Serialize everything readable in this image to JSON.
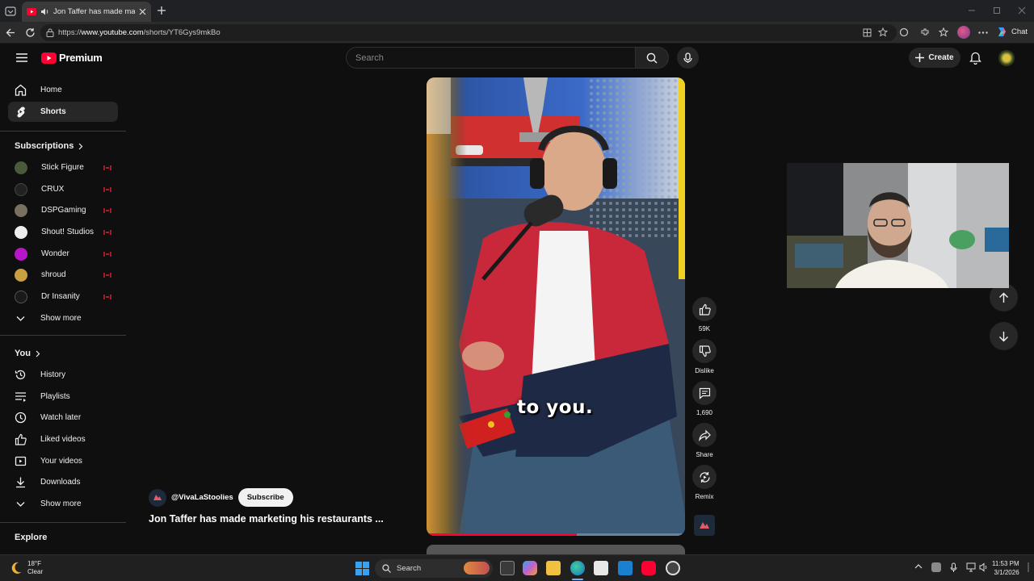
{
  "browser": {
    "tab_title": "Jon Taffer has made marketing his restaurants a",
    "url_prefix": "https://",
    "url_host": "www.youtube.com",
    "url_path": "/shorts/YT6Gys9mkBo",
    "chat_label": "Chat"
  },
  "header": {
    "logo_text": "Premium",
    "search_placeholder": "Search",
    "create_label": "Create"
  },
  "sidebar": {
    "main": [
      {
        "label": "Home",
        "icon": "home-icon"
      },
      {
        "label": "Shorts",
        "icon": "shorts-icon",
        "active": true
      }
    ],
    "subscriptions_title": "Subscriptions",
    "subscriptions": [
      {
        "label": "Stick Figure",
        "color": "#4a5a3a"
      },
      {
        "label": "CRUX",
        "color": "#222222"
      },
      {
        "label": "DSPGaming",
        "color": "#7a7060"
      },
      {
        "label": "Shout! Studios",
        "color": "#eeeeee"
      },
      {
        "label": "Wonder",
        "color": "#b616c8"
      },
      {
        "label": "shroud",
        "color": "#c8a040"
      },
      {
        "label": "Dr Insanity",
        "color": "#1a1a1a"
      }
    ],
    "show_more_1": "Show more",
    "you_title": "You",
    "you_items": [
      {
        "label": "History",
        "icon": "history-icon"
      },
      {
        "label": "Playlists",
        "icon": "playlists-icon"
      },
      {
        "label": "Watch later",
        "icon": "watch-later-icon"
      },
      {
        "label": "Liked videos",
        "icon": "liked-icon"
      },
      {
        "label": "Your videos",
        "icon": "your-videos-icon"
      },
      {
        "label": "Downloads",
        "icon": "downloads-icon"
      }
    ],
    "show_more_2": "Show more",
    "explore_title": "Explore"
  },
  "short": {
    "caption": "to you.",
    "progress_fraction": 0.58,
    "channel": "@VivaLaStoolies",
    "subscribe_label": "Subscribe",
    "title": "Jon Taffer has made marketing his restaurants ...",
    "actions": {
      "like_count": "59K",
      "dislike_label": "Dislike",
      "comment_count": "1,690",
      "share_label": "Share",
      "remix_label": "Remix"
    }
  },
  "taskbar": {
    "weather_temp": "18°F",
    "weather_desc": "Clear",
    "search_label": "Search",
    "time": "11:53 PM",
    "date": "3/1/2026"
  },
  "colors": {
    "accent_red": "#ff0033",
    "bg": "#0f0f0f",
    "chip": "#272727"
  }
}
